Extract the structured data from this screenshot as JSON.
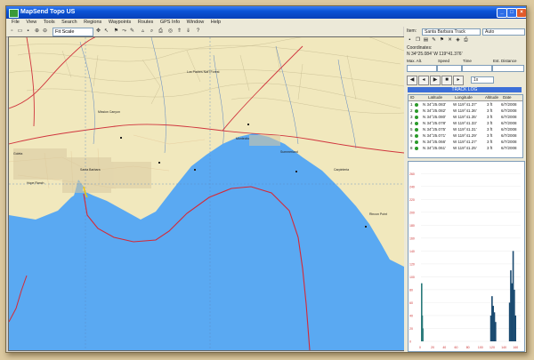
{
  "window": {
    "title": "MapSend Topo US"
  },
  "menu": [
    "File",
    "View",
    "Tools",
    "Search",
    "Regions",
    "Waypoints",
    "Routes",
    "GPS Info",
    "Window",
    "Help"
  ],
  "toolbar": {
    "scale": "Fit Scale"
  },
  "panel": {
    "item_label": "Item:",
    "item_value": "Santa Barbara Track",
    "item_type": "Auto",
    "coords_label": "Coordinates:",
    "coords_value": "N 34°25.084' W 119°41.376'",
    "stat_labels": [
      "Max. Alt.",
      "Speed",
      "Time",
      "Est. Distance"
    ],
    "playback_speed": "1x",
    "table_title": "TRACK LOG",
    "columns": [
      "ID",
      "Latitude",
      "Longitude",
      "Altitude",
      "Date"
    ],
    "rows": [
      {
        "id": "1",
        "lat": "N 34°25.083'",
        "lon": "W 119°41.37'",
        "alt": "3 ft",
        "date": "6/7/2008"
      },
      {
        "id": "2",
        "lat": "N 34°25.082'",
        "lon": "W 119°41.36'",
        "alt": "3 ft",
        "date": "6/7/2008"
      },
      {
        "id": "3",
        "lat": "N 34°25.080'",
        "lon": "W 119°41.35'",
        "alt": "3 ft",
        "date": "6/7/2008"
      },
      {
        "id": "4",
        "lat": "N 34°25.078'",
        "lon": "W 119°41.33'",
        "alt": "3 ft",
        "date": "6/7/2008"
      },
      {
        "id": "5",
        "lat": "N 34°25.075'",
        "lon": "W 119°41.31'",
        "alt": "3 ft",
        "date": "6/7/2008"
      },
      {
        "id": "6",
        "lat": "N 34°25.071'",
        "lon": "W 119°41.29'",
        "alt": "3 ft",
        "date": "6/7/2008"
      },
      {
        "id": "7",
        "lat": "N 34°25.066'",
        "lon": "W 119°41.27'",
        "alt": "3 ft",
        "date": "6/7/2008"
      },
      {
        "id": "8",
        "lat": "N 34°25.061'",
        "lon": "W 119°41.25'",
        "alt": "3 ft",
        "date": "6/7/2008"
      }
    ]
  },
  "map": {
    "labels": [
      "Santa Barbara",
      "Montecito",
      "Summerland",
      "Carpinteria",
      "Goleta",
      "Mission Canyon",
      "Los Padres Nat'l Forest",
      "Rincon Point",
      "Hope Ranch"
    ],
    "colors": {
      "land": "#f1e8bd",
      "water": "#5aa9f2",
      "road": "#d0353e",
      "track": "#d62835",
      "grid": "#5a88c0"
    }
  },
  "chart_data": {
    "type": "bar",
    "x_ticks": [
      "0",
      "20",
      "40",
      "60",
      "80",
      "100",
      "120",
      "140",
      "160"
    ],
    "y_ticks": [
      "0",
      "20",
      "40",
      "60",
      "80",
      "100",
      "120",
      "140",
      "160",
      "180",
      "200",
      "220",
      "240",
      "260"
    ],
    "ylim": [
      0,
      270
    ],
    "xlim": [
      0,
      170
    ],
    "series": [
      {
        "x": [
          0,
          1,
          2
        ],
        "values": [
          90,
          40,
          20
        ],
        "color": "#2a7a7a"
      },
      {
        "x": [
          118,
          120,
          122,
          124,
          126
        ],
        "values": [
          40,
          70,
          55,
          45,
          30
        ],
        "color": "#1a4a70"
      },
      {
        "x": [
          150,
          152,
          154,
          156,
          158,
          160
        ],
        "values": [
          60,
          110,
          90,
          140,
          80,
          40
        ],
        "color": "#1a4a70"
      }
    ]
  }
}
